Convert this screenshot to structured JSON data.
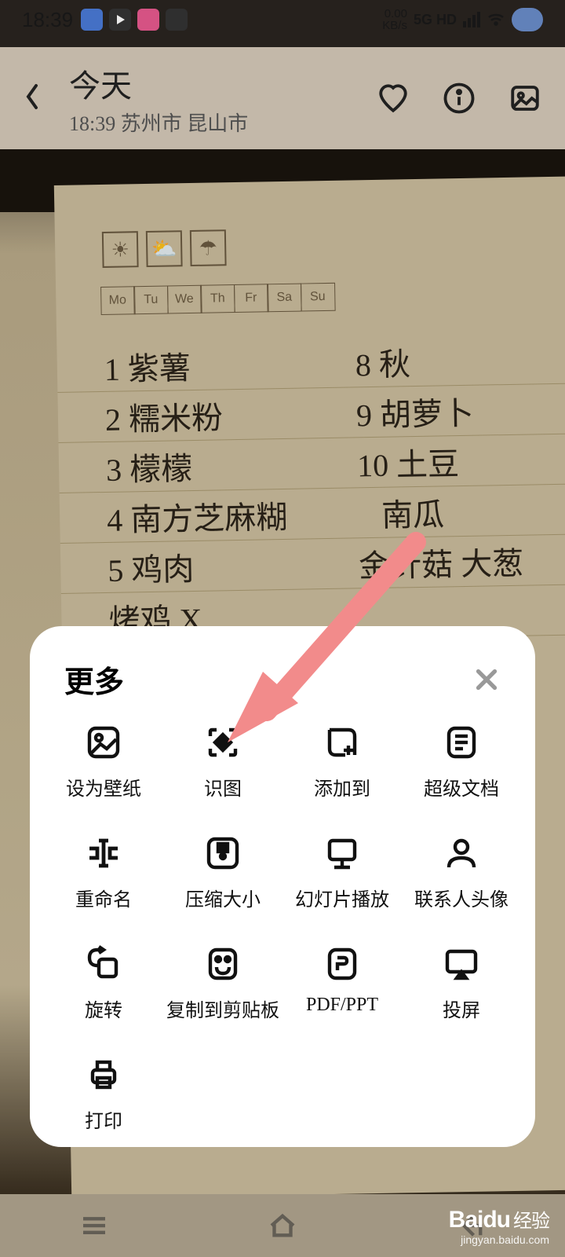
{
  "statusbar": {
    "time": "18:39",
    "kbs_top": "0.00",
    "kbs_bot": "KB/s",
    "net": "5G HD"
  },
  "header": {
    "title": "今天",
    "subtitle": "18:39 苏州市 昆山市"
  },
  "paper": {
    "days": [
      "Mo",
      "Tu",
      "We",
      "Th",
      "Fr",
      "Sa",
      "Su"
    ],
    "rows": [
      {
        "l": "1 紫薯",
        "r": "8 秋"
      },
      {
        "l": "2 糯米粉",
        "r": "9 胡萝卜"
      },
      {
        "l": "3 檬檬",
        "r": "10 土豆"
      },
      {
        "l": "4 南方芝麻糊",
        "r": "南瓜"
      },
      {
        "l": "5 鸡肉",
        "r": "金针菇 大葱"
      },
      {
        "l": "烤鸡 X",
        "r": ""
      }
    ]
  },
  "sheet": {
    "title": "更多",
    "items": [
      {
        "id": "set-wallpaper",
        "label": "设为壁纸"
      },
      {
        "id": "scan",
        "label": "识图"
      },
      {
        "id": "add-to",
        "label": "添加到"
      },
      {
        "id": "super-doc",
        "label": "超级文档"
      },
      {
        "id": "rename",
        "label": "重命名"
      },
      {
        "id": "compress",
        "label": "压缩大小"
      },
      {
        "id": "slideshow",
        "label": "幻灯片播放"
      },
      {
        "id": "contact-avatar",
        "label": "联系人头像"
      },
      {
        "id": "rotate",
        "label": "旋转"
      },
      {
        "id": "copy-clipboard",
        "label": "复制到剪贴板"
      },
      {
        "id": "pdf-ppt",
        "label": "PDF/PPT"
      },
      {
        "id": "cast",
        "label": "投屏"
      },
      {
        "id": "print",
        "label": "打印"
      }
    ]
  },
  "watermark": {
    "brand": "Baidu",
    "brand_cn": "经验",
    "url": "jingyan.baidu.com"
  }
}
